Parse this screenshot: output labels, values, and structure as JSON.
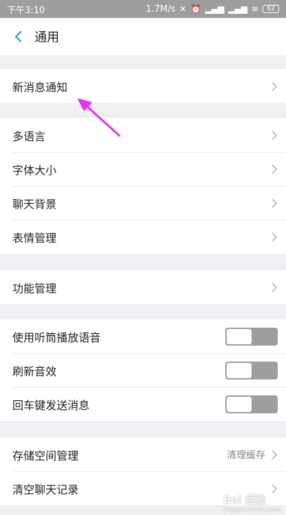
{
  "status_bar": {
    "time": "下午3:10",
    "network_speed": "1.7M/s",
    "battery": "62"
  },
  "header": {
    "title": "通用"
  },
  "groups": [
    {
      "items": [
        {
          "label": "新消息通知"
        }
      ]
    },
    {
      "items": [
        {
          "label": "多语言"
        },
        {
          "label": "字体大小"
        },
        {
          "label": "聊天背景"
        },
        {
          "label": "表情管理"
        }
      ]
    },
    {
      "items": [
        {
          "label": "功能管理"
        }
      ]
    },
    {
      "items": [
        {
          "label": "使用听筒播放语音",
          "toggle": false
        },
        {
          "label": "刷新音效",
          "toggle": false
        },
        {
          "label": "回车键发送消息",
          "toggle": false
        }
      ]
    },
    {
      "items": [
        {
          "label": "存储空间管理",
          "value": "清理缓存"
        },
        {
          "label": "清空聊天记录"
        }
      ]
    }
  ],
  "watermark": {
    "text": "Bai 经验",
    "sub": "jingyan.baidu.com"
  },
  "colors": {
    "accent": "#1e9fe0",
    "annotation_arrow": "#e633e6",
    "background": "#efeff4",
    "toggle_off": "#9e9e9e"
  }
}
